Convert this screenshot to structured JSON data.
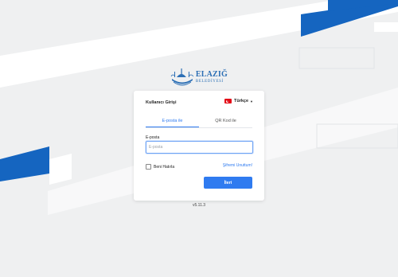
{
  "colors": {
    "background": "#eff0f1",
    "accent": "#2f7bf0",
    "brand_blue": "#1565c0",
    "flag_red": "#e30a17"
  },
  "logo": {
    "title": "ELAZIĞ",
    "subtitle": "BELEDİYESİ",
    "icon": "mosque-emblem-icon"
  },
  "login": {
    "title": "Kullanıcı Girişi",
    "language": {
      "selected": "Türkçe",
      "flag_icon": "turkey-flag-icon",
      "caret_icon": "caret-down-icon"
    },
    "tabs": [
      {
        "label": "E-posta ile",
        "active": true
      },
      {
        "label": "QR Kod ile",
        "active": false
      }
    ],
    "email": {
      "label": "E-posta",
      "placeholder": "E-posta",
      "value": ""
    },
    "remember_me": {
      "label": "Beni Hatırla",
      "checked": false
    },
    "forgot_password": "Şifremi Unuttum!",
    "submit": "İleri"
  },
  "version": "v5.11.3"
}
